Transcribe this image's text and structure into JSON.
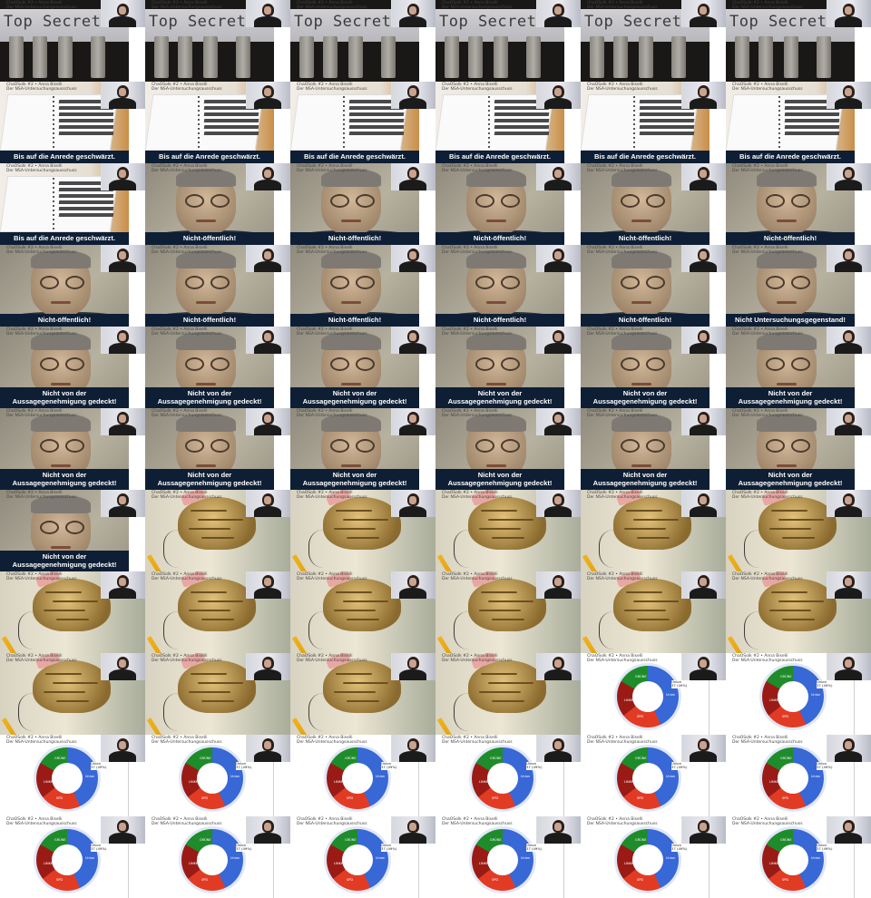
{
  "header": {
    "line1": "ChaOSolk #2 • Anna Biselli",
    "line2": "Der NSA-Untersuchungsausschuss"
  },
  "scenes": {
    "topsecret": {
      "word": "Top Secret"
    },
    "folder": {
      "caption": "Bis auf die Anrede geschwärzt."
    },
    "portrait_public": {
      "caption": "Nicht-öffentlich!"
    },
    "portrait_subject": {
      "caption": "Nicht  Untersuchungsgegenstand!"
    },
    "portrait_aussage": {
      "caption_line1": "Nicht von der",
      "caption_line2": "Aussagegenehmigung gedeckt!"
    },
    "donut": {
      "labels": [
        "Union",
        "SPD",
        "LINKE",
        "GRÜNE"
      ],
      "legend_line1": "Union",
      "legend_line2": "37 (49%)"
    }
  },
  "layout_sequence": [
    "topsecret",
    "topsecret",
    "topsecret",
    "topsecret",
    "topsecret",
    "topsecret",
    "folder",
    "folder",
    "folder",
    "folder",
    "folder",
    "folder",
    "folder",
    "portrait_public",
    "portrait_public",
    "portrait_public",
    "portrait_public",
    "portrait_public",
    "portrait_public",
    "portrait_public",
    "portrait_public",
    "portrait_public",
    "portrait_public",
    "portrait_subject",
    "portrait_aussage",
    "portrait_aussage",
    "portrait_aussage",
    "portrait_aussage",
    "portrait_aussage",
    "portrait_aussage",
    "portrait_aussage",
    "portrait_aussage",
    "portrait_aussage",
    "portrait_aussage",
    "portrait_aussage",
    "portrait_aussage",
    "portrait_aussage",
    "brain",
    "brain",
    "brain",
    "brain",
    "brain",
    "brain",
    "brain",
    "brain",
    "brain",
    "brain",
    "brain",
    "brain",
    "brain",
    "brain",
    "brain",
    "donut",
    "donut",
    "donut",
    "donut",
    "donut",
    "donut",
    "donut",
    "donut",
    "donut",
    "donut",
    "donut",
    "donut",
    "donut",
    "donut"
  ],
  "colors": {
    "caption_bg": "#0e1f35",
    "donut_blue": "#3867d6",
    "donut_red": "#e23b24",
    "donut_darkred": "#9a1b16",
    "donut_green": "#1e8c2a"
  }
}
